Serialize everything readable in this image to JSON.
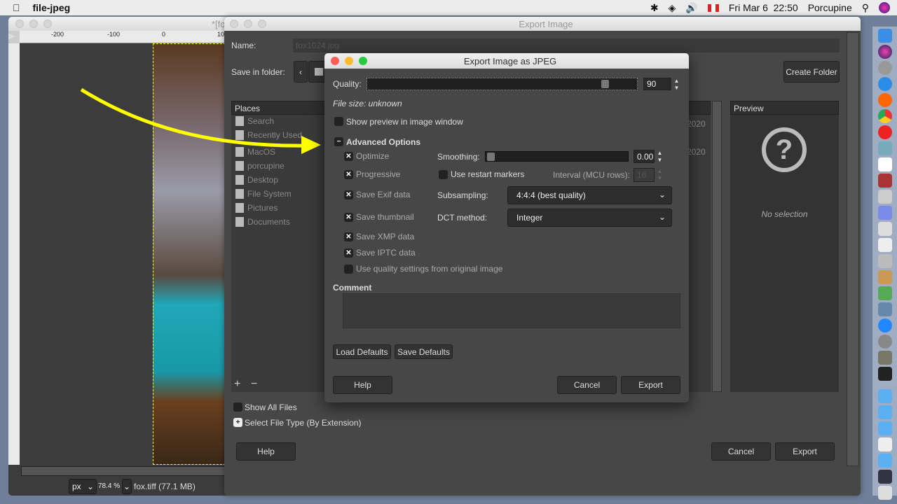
{
  "menubar": {
    "app_name": "file-jpeg",
    "date": "Fri Mar 6",
    "time": "22:50",
    "user": "Porcupine",
    "icons": [
      "apple-icon",
      "bluetooth-icon",
      "wifi-icon",
      "volume-icon",
      "canada-flag-icon",
      "search-icon",
      "siri-icon"
    ]
  },
  "gimp_window": {
    "title": "*[fox",
    "ruler_labels": [
      "-200",
      "-100",
      "0",
      "100"
    ],
    "unit": "px",
    "zoom": "78.4 %",
    "file_info": "fox.tiff (77.1 MB)"
  },
  "export_dialog": {
    "title": "Export Image",
    "name_label": "Name:",
    "name_value": "fox1024.jpg",
    "save_in_label": "Save in folder:",
    "create_folder": "Create Folder",
    "places_header": "Places",
    "places": [
      "Search",
      "Recently Used",
      "MacOS",
      "porcupine",
      "Desktop",
      "File System",
      "Pictures",
      "Documents"
    ],
    "modified_header": "ed",
    "dates": [
      "2020",
      "2020"
    ],
    "preview_header": "Preview",
    "no_selection": "No selection",
    "show_all_files": "Show All Files",
    "select_file_type": "Select File Type (By Extension)",
    "help": "Help",
    "cancel": "Cancel",
    "export": "Export"
  },
  "jpeg_dialog": {
    "title": "Export Image as JPEG",
    "quality_label": "Quality:",
    "quality_value": "90",
    "quality": 90,
    "file_size": "File size: unknown",
    "show_preview": "Show preview in image window",
    "advanced": "Advanced Options",
    "options": [
      {
        "label": "Optimize",
        "checked": true
      },
      {
        "label": "Progressive",
        "checked": true
      },
      {
        "label": "Save Exif data",
        "checked": true
      },
      {
        "label": "Save thumbnail",
        "checked": true
      },
      {
        "label": "Save XMP data",
        "checked": true
      },
      {
        "label": "Save IPTC data",
        "checked": true
      },
      {
        "label": "Use quality settings from original image",
        "checked": false
      }
    ],
    "smoothing_label": "Smoothing:",
    "smoothing_value": "0.00",
    "restart_markers": "Use restart markers",
    "interval_label": "Interval (MCU rows):",
    "interval_value": "16",
    "subsampling_label": "Subsampling:",
    "subsampling_value": "4:4:4 (best quality)",
    "dct_label": "DCT method:",
    "dct_value": "Integer",
    "comment_label": "Comment",
    "load_defaults": "Load Defaults",
    "save_defaults": "Save Defaults",
    "help": "Help",
    "cancel": "Cancel",
    "export": "Export"
  },
  "colors": {
    "annotation_arrow": "#ffff00",
    "dialog_bg": "#474747"
  }
}
